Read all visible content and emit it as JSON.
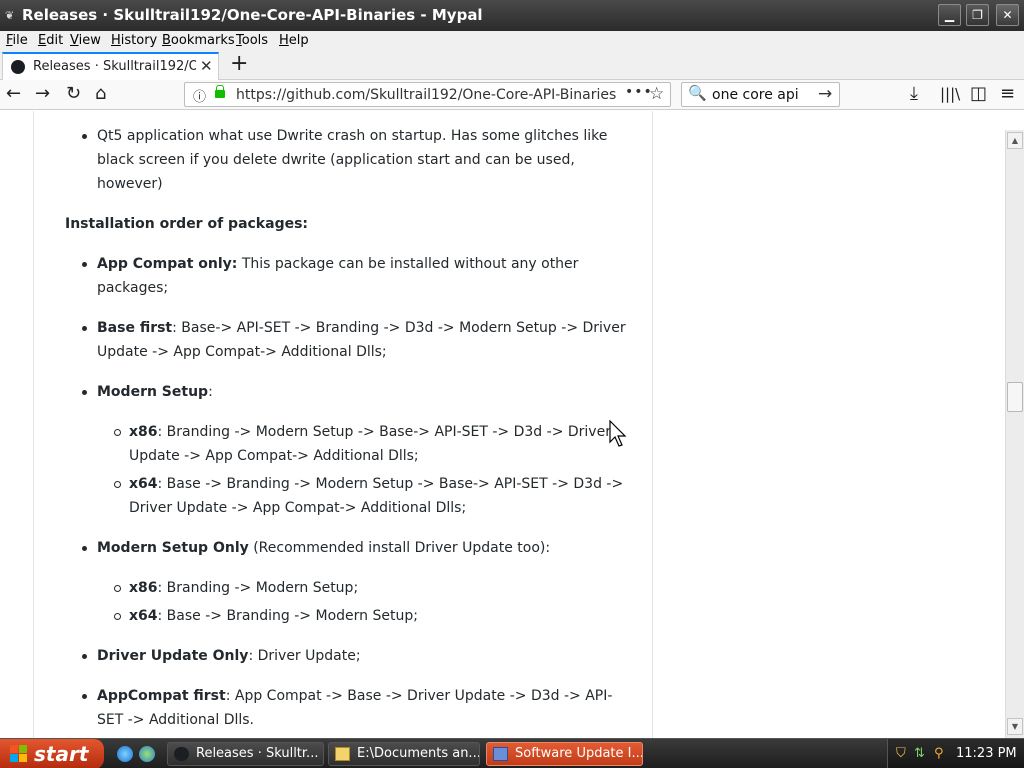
{
  "window": {
    "title": "Releases · Skulltrail192/One-Core-API-Binaries - Mypal"
  },
  "menu": [
    "File",
    "Edit",
    "View",
    "History",
    "Bookmarks",
    "Tools",
    "Help"
  ],
  "tab": {
    "title": "Releases · Skulltrail192/One-Core-API-Binaries"
  },
  "navbar": {
    "url": "https://github.com/Skulltrail192/One-Core-API-Binaries",
    "search_value": "one core api"
  },
  "article": {
    "intro_bullet": "Qt5 application what use Dwrite crash on startup. Has some glitches like black screen if you delete dwrite (application start and can be used, however)",
    "heading": "Installation order of packages:",
    "items": [
      {
        "label": "App Compat only:",
        "text": " This package can be installed without any other packages;"
      },
      {
        "label": "Base first",
        "text": ": Base-> API-SET -> Branding -> D3d -> Modern Setup -> Driver Update -> App Compat-> Additional Dlls;"
      },
      {
        "label": "Modern Setup",
        "text": ":"
      },
      {
        "label": "Modern Setup Only",
        "text": " (Recommended install Driver Update too):"
      },
      {
        "label": "Driver Update Only",
        "text": ": Driver Update;"
      },
      {
        "label": "AppCompat first",
        "text": ": App Compat -> Base -> Driver Update -> D3d -> API-SET -> Additional Dlls."
      }
    ],
    "modern_setup_subs": [
      {
        "label": "x86",
        "text": ": Branding -> Modern Setup -> Base-> API-SET -> D3d -> Driver Update -> App Compat-> Additional Dlls;"
      },
      {
        "label": "x64",
        "text": ": Base -> Branding -> Modern Setup -> Base-> API-SET -> D3d -> Driver Update -> App Compat-> Additional Dlls;"
      }
    ],
    "modern_setup_only_subs": [
      {
        "label": "x86",
        "text": ": Branding -> Modern Setup;"
      },
      {
        "label": "x64",
        "text": ": Base -> Branding -> Modern Setup;"
      }
    ]
  },
  "taskbar": {
    "start_label": "start",
    "tasks": [
      {
        "label": "Releases · Skulltr..."
      },
      {
        "label": "E:\\Documents an..."
      },
      {
        "label": "Software Update I..."
      }
    ],
    "clock": "11:23 PM"
  },
  "colors": {
    "tab_accent": "#0a84ff",
    "lock": "#12bc00",
    "start": "#c9401b"
  },
  "scroll_position": 0.45
}
